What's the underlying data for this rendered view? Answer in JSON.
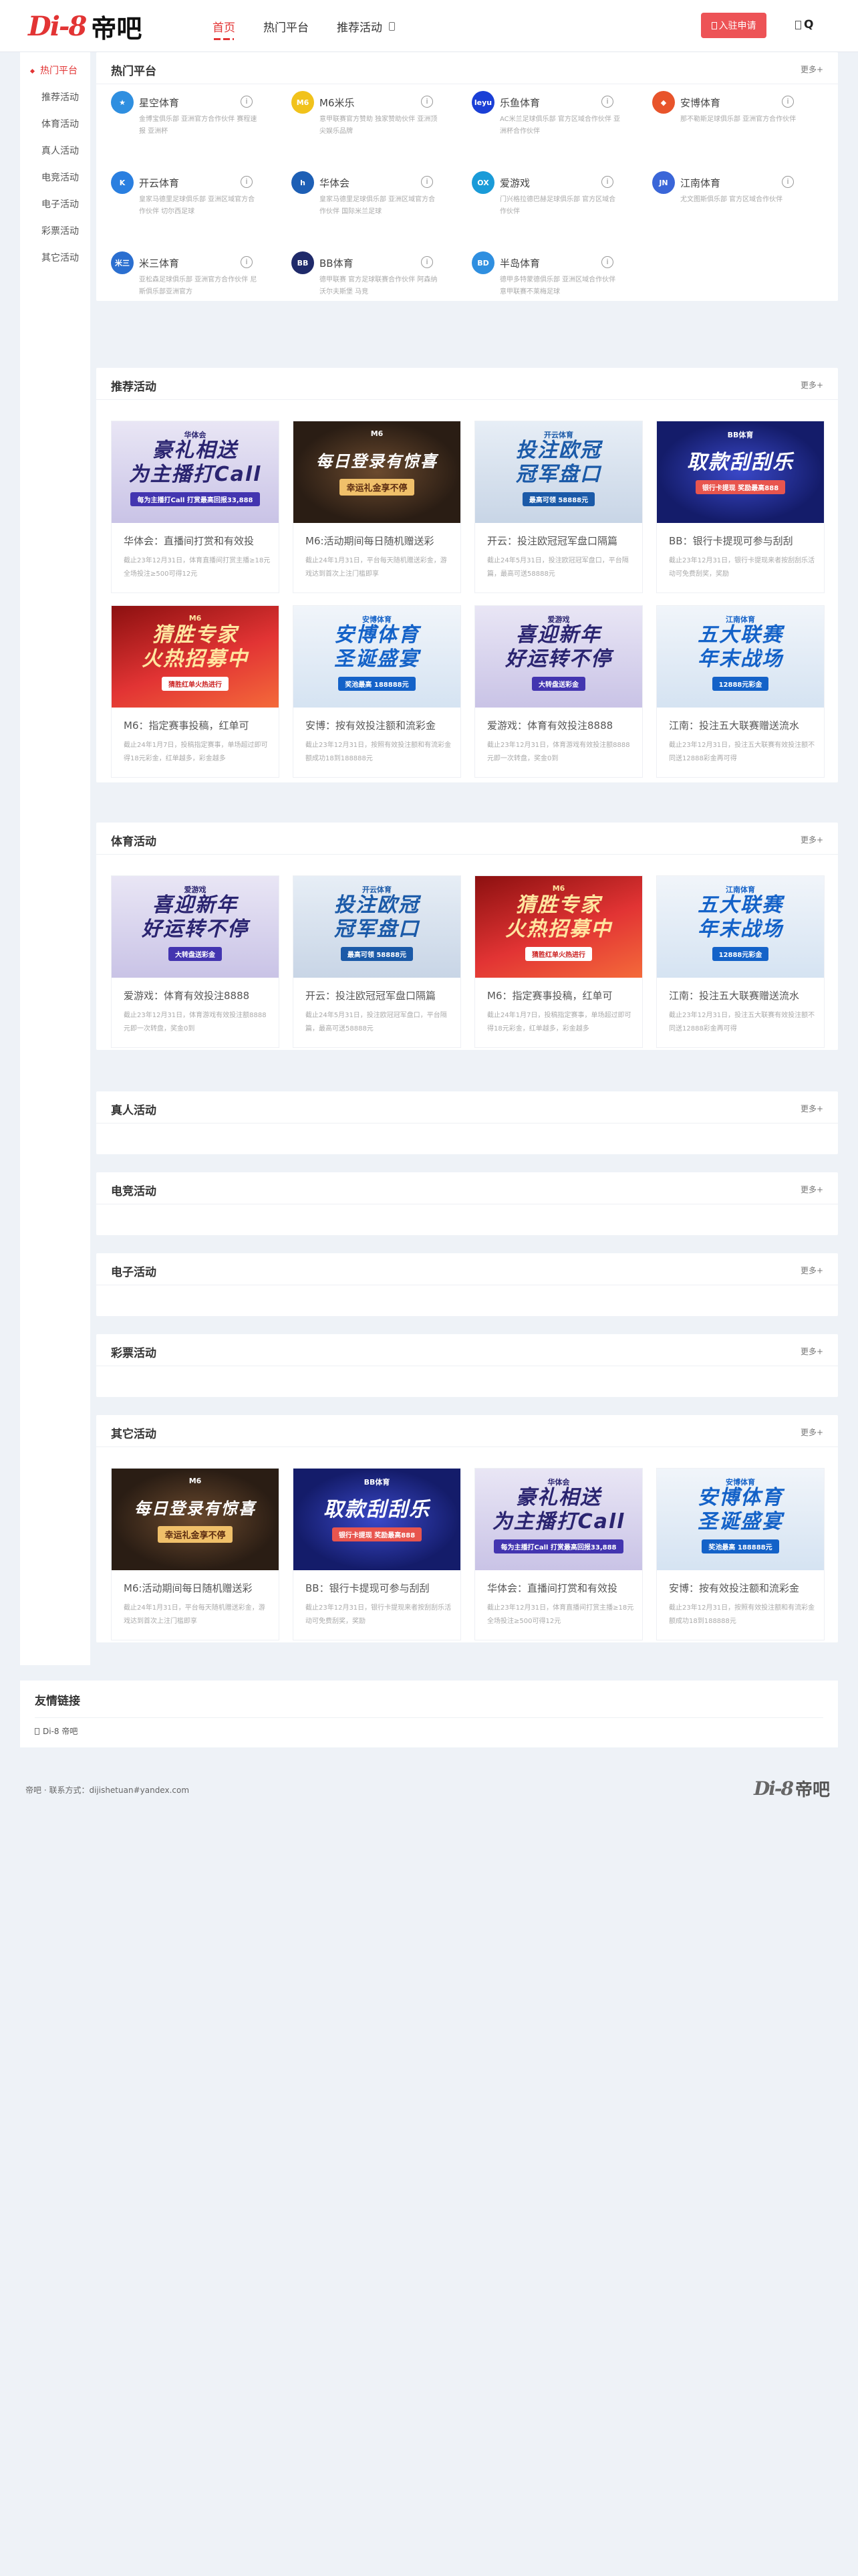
{
  "brand": {
    "mark": "Di-8",
    "cn": "帝吧"
  },
  "nav": [
    {
      "label": "首页"
    },
    {
      "label": "热门平台"
    },
    {
      "label": "推荐活动"
    }
  ],
  "header": {
    "join_label": "入驻申请",
    "search_label": "Q"
  },
  "sidebar": [
    {
      "label": "热门平台"
    },
    {
      "label": "推荐活动"
    },
    {
      "label": "体育活动"
    },
    {
      "label": "真人活动"
    },
    {
      "label": "电竞活动"
    },
    {
      "label": "电子活动"
    },
    {
      "label": "彩票活动"
    },
    {
      "label": "其它活动"
    }
  ],
  "more_label": "更多+",
  "sections": {
    "hot": "热门平台",
    "recommend": "推荐活动",
    "sports": "体育活动",
    "live": "真人活动",
    "esports": "电竞活动",
    "slots": "电子活动",
    "lottery": "彩票活动",
    "other": "其它活动"
  },
  "platforms": [
    {
      "name": "星空体育",
      "logo_text": "★",
      "color": "#2f8fe0",
      "desc": "金博宝俱乐部 亚洲官方合作伙伴 赛程速报 亚洲杯"
    },
    {
      "name": "M6米乐",
      "logo_text": "M6",
      "color": "#f1c21b",
      "desc": "意甲联赛官方赞助 独家赞助伙伴 亚洲顶尖娱乐品牌"
    },
    {
      "name": "乐鱼体育",
      "logo_text": "leyu",
      "color": "#1a3fd6",
      "desc": "AC米兰足球俱乐部 官方区域合作伙伴 亚洲杯合作伙伴"
    },
    {
      "name": "安博体育",
      "logo_text": "◆",
      "color": "#e8542b",
      "desc": "那不勒斯足球俱乐部 亚洲官方合作伙伴"
    },
    {
      "name": "开云体育",
      "logo_text": "K",
      "color": "#2a7fe0",
      "desc": "皇家马德里足球俱乐部 亚洲区域官方合作伙伴 切尔西足球"
    },
    {
      "name": "华体会",
      "logo_text": "h",
      "color": "#1d5fb5",
      "desc": "皇家马德里足球俱乐部 亚洲区域官方合作伙伴 国际米兰足球"
    },
    {
      "name": "爱游戏",
      "logo_text": "OX",
      "color": "#1a9bd8",
      "desc": "门兴格拉德巴赫足球俱乐部 官方区域合作伙伴"
    },
    {
      "name": "江南体育",
      "logo_text": "JN",
      "color": "#3a66d8",
      "desc": "尤文图斯俱乐部 官方区域合作伙伴"
    },
    {
      "name": "米三体育",
      "logo_text": "米三",
      "color": "#2b6fd0",
      "desc": "亚松森足球俱乐部 亚洲官方合作伙伴 尼斯俱乐部亚洲官方"
    },
    {
      "name": "BB体育",
      "logo_text": "BB",
      "color": "#1f2a6a",
      "desc": "德甲联赛 官方足球联赛合作伙伴 阿森纳 沃尔夫斯堡 马竞"
    },
    {
      "name": "半岛体育",
      "logo_text": "BD",
      "color": "#2f8fe0",
      "desc": "德甲多特蒙德俱乐部 亚洲区域合作伙伴 意甲联赛不莱梅足球"
    }
  ],
  "recommend_cards": [
    {
      "theme": "th-purple",
      "brand": "华体会",
      "t1": "豪礼相送",
      "t2": "为主播打Call",
      "sub": "每为主播打Call 打赏最高回报33,888",
      "title": "华体会：直播间打赏和有效投",
      "desc": "截止23年12月31日，体育直播间打赏主播≥18元全场投注≥500可得12元"
    },
    {
      "theme": "th-dark",
      "brand": "M6",
      "t1": "每日登录有惊喜",
      "t2": "",
      "sub": "幸运礼金享不停",
      "title": "M6:活动期间每日随机赠送彩",
      "desc": "截止24年1月31日，平台每天随机赠送彩金，游戏达到首次上注门槛即享"
    },
    {
      "theme": "th-cyan",
      "brand": "开云体育",
      "t1": "投注欧冠",
      "t2": "冠军盘口",
      "sub": "最高可领 58888元",
      "title": "开云：投注欧冠冠军盘口隔篇",
      "desc": "截止24年5月31日，投注欧冠冠军盘口，平台隔篇，最高可送58888元"
    },
    {
      "theme": "th-navy",
      "brand": "BB体育",
      "t1": "取款刮刮乐",
      "t2": "",
      "sub": "银行卡提现 奖励最高888",
      "title": "BB：银行卡提现可参与刮刮",
      "desc": "截止23年12月31日，银行卡提现来者按刮刮乐活动可免费刮奖，奖励"
    },
    {
      "theme": "th-red",
      "brand": "M6",
      "t1": "猜胜专家",
      "t2": "火热招募中",
      "sub": "猜胜红单火热进行",
      "title": "M6：指定赛事投稿，红单可",
      "desc": "截止24年1月7日，投稿指定赛事，单场超过即可得18元彩金，红单越多，彩金越多"
    },
    {
      "theme": "th-light",
      "brand": "安博体育",
      "t1": "安博体育",
      "t2": "圣诞盛宴",
      "sub": "奖池最高 188888元",
      "title": "安博：按有效投注额和流彩金",
      "desc": "截止23年12月31日，按照有效投注额和有流彩金额成功18到188888元"
    },
    {
      "theme": "th-purple",
      "brand": "爱游戏",
      "t1": "喜迎新年",
      "t2": "好运转不停",
      "sub": "大转盘送彩金",
      "title": "爱游戏：体育有效投注8888",
      "desc": "截止23年12月31日，体育游戏有效投注额8888元即一次转盘，奖金0到"
    },
    {
      "theme": "th-light",
      "brand": "江南体育",
      "t1": "五大联赛",
      "t2": "年末战场",
      "sub": "12888元彩金",
      "title": "江南：投注五大联赛赠送流水",
      "desc": "截止23年12月31日，投注五大联赛有效投注额不同送12888彩金再可得"
    }
  ],
  "sports_cards": [
    {
      "theme": "th-purple",
      "brand": "爱游戏",
      "t1": "喜迎新年",
      "t2": "好运转不停",
      "sub": "大转盘送彩金",
      "title": "爱游戏：体育有效投注8888",
      "desc": "截止23年12月31日，体育游戏有效投注额8888元即一次转盘，奖金0到"
    },
    {
      "theme": "th-cyan",
      "brand": "开云体育",
      "t1": "投注欧冠",
      "t2": "冠军盘口",
      "sub": "最高可领 58888元",
      "title": "开云：投注欧冠冠军盘口隔篇",
      "desc": "截止24年5月31日，投注欧冠冠军盘口，平台隔篇，最高可送58888元"
    },
    {
      "theme": "th-red",
      "brand": "M6",
      "t1": "猜胜专家",
      "t2": "火热招募中",
      "sub": "猜胜红单火热进行",
      "title": "M6：指定赛事投稿，红单可",
      "desc": "截止24年1月7日，投稿指定赛事，单场超过即可得18元彩金，红单越多，彩金越多"
    },
    {
      "theme": "th-light",
      "brand": "江南体育",
      "t1": "五大联赛",
      "t2": "年末战场",
      "sub": "12888元彩金",
      "title": "江南：投注五大联赛赠送流水",
      "desc": "截止23年12月31日，投注五大联赛有效投注额不同送12888彩金再可得"
    }
  ],
  "other_cards": [
    {
      "theme": "th-dark",
      "brand": "M6",
      "t1": "每日登录有惊喜",
      "t2": "",
      "sub": "幸运礼金享不停",
      "title": "M6:活动期间每日随机赠送彩",
      "desc": "截止24年1月31日，平台每天随机赠送彩金，游戏达到首次上注门槛即享"
    },
    {
      "theme": "th-navy",
      "brand": "BB体育",
      "t1": "取款刮刮乐",
      "t2": "",
      "sub": "银行卡提现 奖励最高888",
      "title": "BB：银行卡提现可参与刮刮",
      "desc": "截止23年12月31日，银行卡提现来者按刮刮乐活动可免费刮奖，奖励"
    },
    {
      "theme": "th-purple",
      "brand": "华体会",
      "t1": "豪礼相送",
      "t2": "为主播打Call",
      "sub": "每为主播打Call 打赏最高回报33,888",
      "title": "华体会：直播间打赏和有效投",
      "desc": "截止23年12月31日，体育直播间打赏主播≥18元全场投注≥500可得12元"
    },
    {
      "theme": "th-light",
      "brand": "安博体育",
      "t1": "安博体育",
      "t2": "圣诞盛宴",
      "sub": "奖池最高 188888元",
      "title": "安博：按有效投注额和流彩金",
      "desc": "截止23年12月31日，按照有效投注额和有流彩金额成功18到188888元"
    }
  ],
  "friends": {
    "title": "友情链接",
    "link": "Di-8 帝吧"
  },
  "footer": {
    "text": "帝吧 · 联系方式：dijishetuan#yandex.com"
  }
}
